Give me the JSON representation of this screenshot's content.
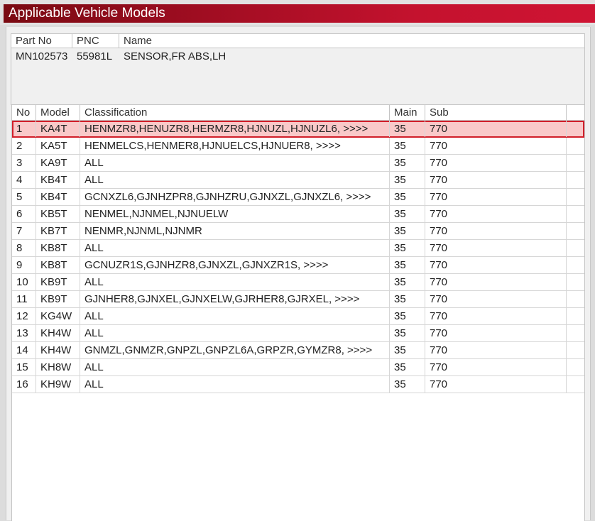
{
  "window": {
    "title": "Applicable Vehicle Models"
  },
  "part_info": {
    "headers": {
      "part_no": "Part No",
      "pnc": "PNC",
      "name": "Name"
    },
    "row": {
      "part_no": "MN102573",
      "pnc": "55981L",
      "name": "SENSOR,FR ABS,LH"
    }
  },
  "vehicle_table": {
    "headers": {
      "no": "No",
      "model": "Model",
      "classification": "Classification",
      "main": "Main",
      "sub": "Sub"
    },
    "selected_index": 0,
    "rows": [
      {
        "no": "1",
        "model": "KA4T",
        "classification": "HENMZR8,HENUZR8,HERMZR8,HJNUZL,HJNUZL6,  >>>>",
        "main": "35",
        "sub": "770"
      },
      {
        "no": "2",
        "model": "KA5T",
        "classification": "HENMELCS,HENMER8,HJNUELCS,HJNUER8,  >>>>",
        "main": "35",
        "sub": "770"
      },
      {
        "no": "3",
        "model": "KA9T",
        "classification": "ALL",
        "main": "35",
        "sub": "770"
      },
      {
        "no": "4",
        "model": "KB4T",
        "classification": "ALL",
        "main": "35",
        "sub": "770"
      },
      {
        "no": "5",
        "model": "KB4T",
        "classification": "GCNXZL6,GJNHZPR8,GJNHZRU,GJNXZL,GJNXZL6,  >>>>",
        "main": "35",
        "sub": "770"
      },
      {
        "no": "6",
        "model": "KB5T",
        "classification": "NENMEL,NJNMEL,NJNUELW",
        "main": "35",
        "sub": "770"
      },
      {
        "no": "7",
        "model": "KB7T",
        "classification": "NENMR,NJNML,NJNMR",
        "main": "35",
        "sub": "770"
      },
      {
        "no": "8",
        "model": "KB8T",
        "classification": "ALL",
        "main": "35",
        "sub": "770"
      },
      {
        "no": "9",
        "model": "KB8T",
        "classification": "GCNUZR1S,GJNHZR8,GJNXZL,GJNXZR1S,  >>>>",
        "main": "35",
        "sub": "770"
      },
      {
        "no": "10",
        "model": "KB9T",
        "classification": "ALL",
        "main": "35",
        "sub": "770"
      },
      {
        "no": "11",
        "model": "KB9T",
        "classification": "GJNHER8,GJNXEL,GJNXELW,GJRHER8,GJRXEL,  >>>>",
        "main": "35",
        "sub": "770"
      },
      {
        "no": "12",
        "model": "KG4W",
        "classification": "ALL",
        "main": "35",
        "sub": "770"
      },
      {
        "no": "13",
        "model": "KH4W",
        "classification": "ALL",
        "main": "35",
        "sub": "770"
      },
      {
        "no": "14",
        "model": "KH4W",
        "classification": "GNMZL,GNMZR,GNPZL,GNPZL6A,GRPZR,GYMZR8,  >>>>",
        "main": "35",
        "sub": "770"
      },
      {
        "no": "15",
        "model": "KH8W",
        "classification": "ALL",
        "main": "35",
        "sub": "770"
      },
      {
        "no": "16",
        "model": "KH9W",
        "classification": "ALL",
        "main": "35",
        "sub": "770"
      }
    ]
  }
}
